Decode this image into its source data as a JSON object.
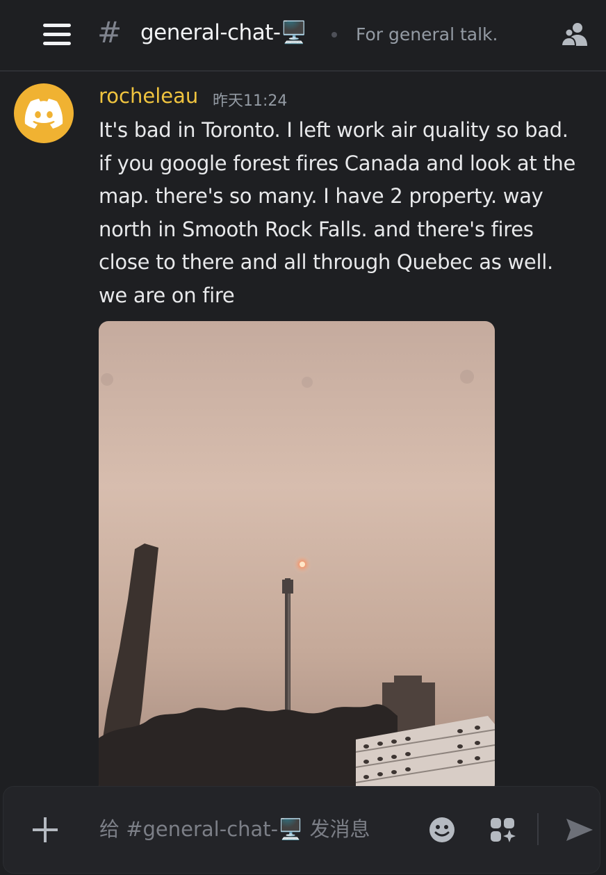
{
  "header": {
    "hash_symbol": "#",
    "channel_name": "general-chat-🖥️",
    "topic": "For general talk."
  },
  "message": {
    "author": "rocheleau",
    "timestamp": "昨天11:24",
    "text": "It's bad in Toronto. I left work air quality so bad. if you google forest fires Canada and look at the map. there's so many. I have 2 property. way north in Smooth Rock Falls. and there's fires close to there and all through Quebec as well. we are on fire",
    "author_color": "#f0c43f",
    "avatar_color": "#f0b232",
    "attachment": "photo-smoky-sky-toronto"
  },
  "composer": {
    "placeholder": "给 #general-chat-🖥️ 发消息"
  },
  "icons": {
    "menu": "hamburger-menu-icon",
    "members": "members-icon",
    "add": "plus-icon",
    "emoji": "emoji-icon",
    "apps": "apps-icon",
    "send": "send-icon"
  }
}
